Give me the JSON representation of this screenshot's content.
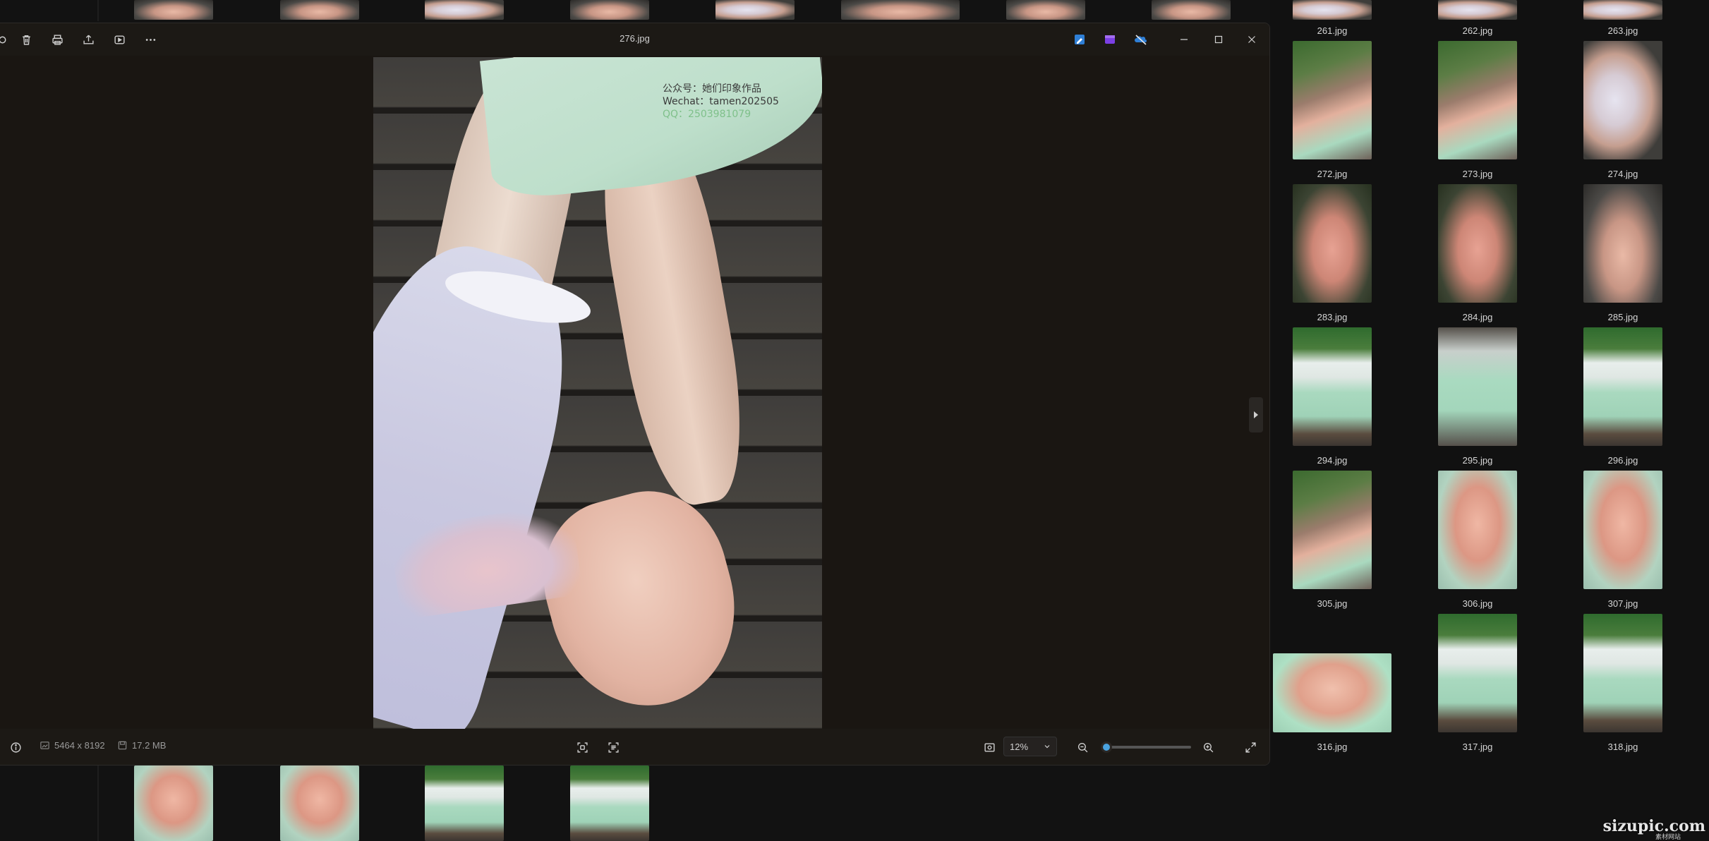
{
  "viewer": {
    "title": "276.jpg",
    "toolbar": {
      "delete_icon": "trash-icon",
      "print_icon": "printer-icon",
      "share_icon": "share-icon",
      "slideshow_icon": "slideshow-icon",
      "more_icon": "more-icon"
    },
    "app_icons": [
      "edit-app-icon",
      "clipchamp-icon",
      "onedrive-icon"
    ],
    "window_controls": [
      "minimize-icon",
      "maximize-icon",
      "close-icon"
    ],
    "image_watermark": {
      "line1": "公众号：她们印象作品",
      "line2": "Wechat：tamen202505",
      "line3": "QQ：2503981079"
    },
    "status": {
      "dimensions": "5464 x 8192",
      "file_size": "17.2 MB",
      "zoom": "12%",
      "zoom_fraction": 0.0
    }
  },
  "gallery": {
    "items": [
      {
        "label": "261.jpg",
        "photo": "feet-w"
      },
      {
        "label": "262.jpg",
        "photo": "feet-w"
      },
      {
        "label": "263.jpg",
        "photo": "feet-w"
      },
      {
        "label": "272.jpg",
        "photo": "rail"
      },
      {
        "label": "273.jpg",
        "photo": "rail"
      },
      {
        "label": "274.jpg",
        "photo": "feet-w"
      },
      {
        "label": "283.jpg",
        "photo": "sole"
      },
      {
        "label": "284.jpg",
        "photo": "sole"
      },
      {
        "label": "285.jpg",
        "photo": "feet"
      },
      {
        "label": "294.jpg",
        "photo": "sitting"
      },
      {
        "label": "295.jpg",
        "photo": "dress"
      },
      {
        "label": "296.jpg",
        "photo": "sitting"
      },
      {
        "label": "305.jpg",
        "photo": "rail"
      },
      {
        "label": "306.jpg",
        "photo": "hands"
      },
      {
        "label": "307.jpg",
        "photo": "hands"
      },
      {
        "label": "316.jpg",
        "photo": "hands-wide"
      },
      {
        "label": "317.jpg",
        "photo": "sitting"
      },
      {
        "label": "318.jpg",
        "photo": "sitting"
      }
    ]
  },
  "site_watermark": {
    "main": "sizupic.com",
    "sub": "素材网站"
  },
  "colors": {
    "accent": "#4aa3e0",
    "watermark_dark": "#3a3a3a",
    "watermark_green": "#7fc08a"
  }
}
